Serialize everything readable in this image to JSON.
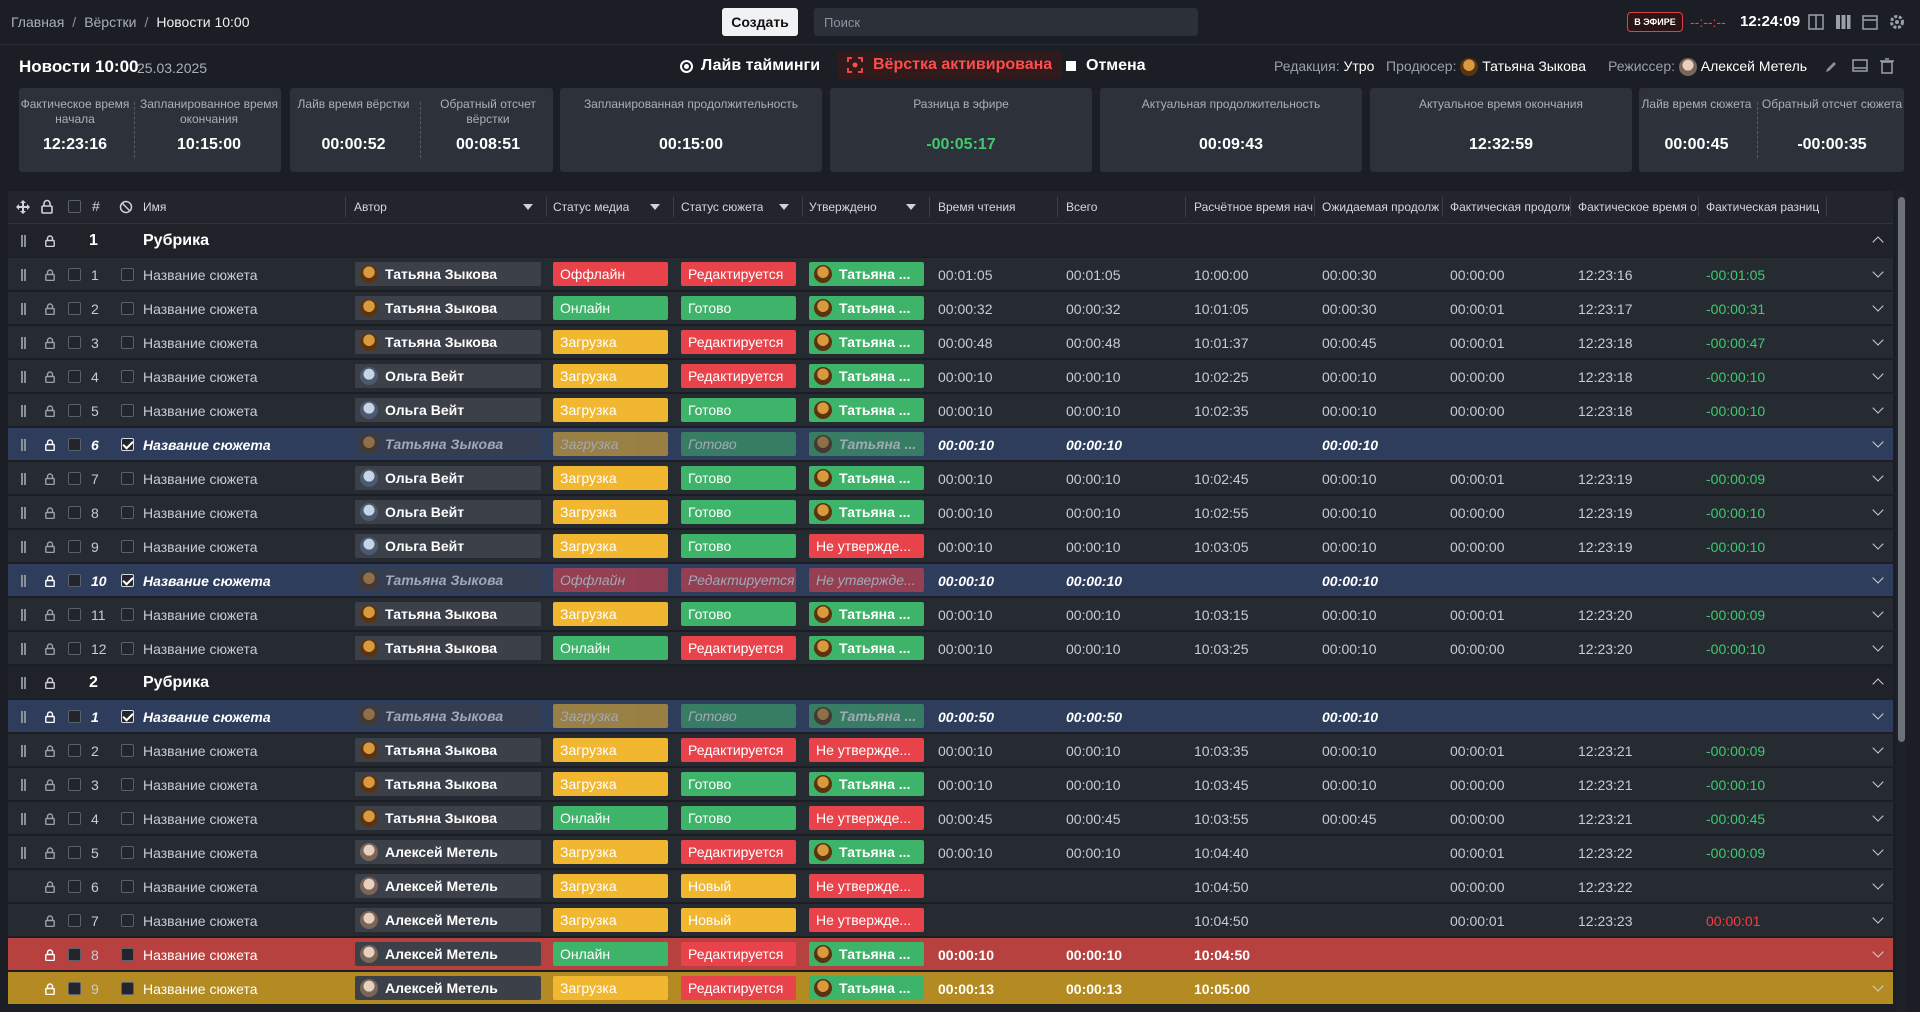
{
  "breadcrumb": [
    "Главная",
    "Вёрстки",
    "Новости 10:00"
  ],
  "toolbar": {
    "create_label": "Создать",
    "search_placeholder": "Поиск",
    "onair_label": "В ЭФИРЕ",
    "countdown": "--:--:--",
    "clock": "12:24:09"
  },
  "page": {
    "title": "Новости 10:00",
    "date": "25.03.2025",
    "live_timings": "Лайв тайминги",
    "activated": "Вёрстка активирована",
    "cancel": "Отмена",
    "edition_label": "Редакция:",
    "edition": "Утро",
    "producer_label": "Продюсер:",
    "producer": "Татьяна Зыкова",
    "director_label": "Режиссер:",
    "director": "Алексей Метель"
  },
  "panels": {
    "actual_start_label": "Фактическое время начала",
    "actual_start": "12:23:16",
    "planned_end_label": "Запланированное время окончания",
    "planned_end": "10:15:00",
    "live_layout_label": "Лайв время вёрстки",
    "live_layout": "00:00:52",
    "countdown_layout_label": "Обратный отсчет вёрстки",
    "countdown_layout": "00:08:51",
    "planned_duration_label": "Запланированная продолжительность",
    "planned_duration": "00:15:00",
    "air_diff_label": "Разница в эфире",
    "air_diff": "-00:05:17",
    "actual_duration_label": "Актуальная продолжительность",
    "actual_duration": "00:09:43",
    "actual_end_label": "Актуальное время окончания",
    "actual_end": "12:32:59",
    "live_story_label": "Лайв время сюжета",
    "live_story": "00:00:45",
    "countdown_story_label": "Обратный отсчет сюжета",
    "countdown_story": "-00:00:35"
  },
  "columns": {
    "name": "Имя",
    "author": "Автор",
    "media": "Статус медиа",
    "story": "Статус сюжета",
    "approved": "Утверждено",
    "read": "Время чтения",
    "total": "Всего",
    "calc": "Расчётное время нач",
    "expected": "Ожидаемая продолж",
    "actual_dur": "Фактическая продолж",
    "actual_time": "Фактическое время о",
    "actual_diff": "Фактическая разниц"
  },
  "groups": [
    {
      "num": "1",
      "title": "Рубрика",
      "rows": [
        {
          "n": "1",
          "name": "Название сюжета",
          "author": "Татьяна Зыкова",
          "av": "t",
          "media": "Оффлайн",
          "story": "Редактируется",
          "appr": "Татьяна ...",
          "read": "00:01:05",
          "total": "00:01:05",
          "calc": "10:00:00",
          "exp": "00:00:30",
          "adur": "00:00:00",
          "atime": "12:23:16",
          "diff": "-00:01:05"
        },
        {
          "n": "2",
          "name": "Название сюжета",
          "author": "Татьяна Зыкова",
          "av": "t",
          "media": "Онлайн",
          "story": "Готово",
          "appr": "Татьяна ...",
          "read": "00:00:32",
          "total": "00:00:32",
          "calc": "10:01:05",
          "exp": "00:00:30",
          "adur": "00:00:01",
          "atime": "12:23:17",
          "diff": "-00:00:31"
        },
        {
          "n": "3",
          "name": "Название сюжета",
          "author": "Татьяна Зыкова",
          "av": "t",
          "media": "Загрузка",
          "story": "Редактируется",
          "appr": "Татьяна ...",
          "read": "00:00:48",
          "total": "00:00:48",
          "calc": "10:01:37",
          "exp": "00:00:45",
          "adur": "00:00:01",
          "atime": "12:23:18",
          "diff": "-00:00:47"
        },
        {
          "n": "4",
          "name": "Название сюжета",
          "author": "Ольга Вейт",
          "av": "o",
          "media": "Загрузка",
          "story": "Редактируется",
          "appr": "Татьяна ...",
          "read": "00:00:10",
          "total": "00:00:10",
          "calc": "10:02:25",
          "exp": "00:00:10",
          "adur": "00:00:00",
          "atime": "12:23:18",
          "diff": "-00:00:10"
        },
        {
          "n": "5",
          "name": "Название сюжета",
          "author": "Ольга Вейт",
          "av": "o",
          "media": "Загрузка",
          "story": "Готово",
          "appr": "Татьяна ...",
          "read": "00:00:10",
          "total": "00:00:10",
          "calc": "10:02:35",
          "exp": "00:00:10",
          "adur": "00:00:00",
          "atime": "12:23:18",
          "diff": "-00:00:10"
        },
        {
          "n": "6",
          "name": "Название сюжета",
          "author": "Татьяна Зыкова",
          "av": "t",
          "media": "Загрузка",
          "story": "Готово",
          "appr": "Татьяна ...",
          "read": "00:00:10",
          "total": "00:00:10",
          "calc": "",
          "exp": "00:00:10",
          "adur": "",
          "atime": "",
          "diff": "",
          "state": "sel"
        },
        {
          "n": "7",
          "name": "Название сюжета",
          "author": "Ольга Вейт",
          "av": "o",
          "media": "Загрузка",
          "story": "Готово",
          "appr": "Татьяна ...",
          "read": "00:00:10",
          "total": "00:00:10",
          "calc": "10:02:45",
          "exp": "00:00:10",
          "adur": "00:00:01",
          "atime": "12:23:19",
          "diff": "-00:00:09"
        },
        {
          "n": "8",
          "name": "Название сюжета",
          "author": "Ольга Вейт",
          "av": "o",
          "media": "Загрузка",
          "story": "Готово",
          "appr": "Татьяна ...",
          "read": "00:00:10",
          "total": "00:00:10",
          "calc": "10:02:55",
          "exp": "00:00:10",
          "adur": "00:00:00",
          "atime": "12:23:19",
          "diff": "-00:00:10"
        },
        {
          "n": "9",
          "name": "Название сюжета",
          "author": "Ольга Вейт",
          "av": "o",
          "media": "Загрузка",
          "story": "Готово",
          "appr": "Не утвержде...",
          "read": "00:00:10",
          "total": "00:00:10",
          "calc": "10:03:05",
          "exp": "00:00:10",
          "adur": "00:00:00",
          "atime": "12:23:19",
          "diff": "-00:00:10"
        },
        {
          "n": "10",
          "name": "Название сюжета",
          "author": "Татьяна Зыкова",
          "av": "t",
          "media": "Оффлайн",
          "story": "Редактируется",
          "appr": "Не утвержде...",
          "read": "00:00:10",
          "total": "00:00:10",
          "calc": "",
          "exp": "00:00:10",
          "adur": "",
          "atime": "",
          "diff": "",
          "state": "sel"
        },
        {
          "n": "11",
          "name": "Название сюжета",
          "author": "Татьяна Зыкова",
          "av": "t",
          "media": "Загрузка",
          "story": "Готово",
          "appr": "Татьяна ...",
          "read": "00:00:10",
          "total": "00:00:10",
          "calc": "10:03:15",
          "exp": "00:00:10",
          "adur": "00:00:01",
          "atime": "12:23:20",
          "diff": "-00:00:09"
        },
        {
          "n": "12",
          "name": "Название сюжета",
          "author": "Татьяна Зыкова",
          "av": "t",
          "media": "Онлайн",
          "story": "Редактируется",
          "appr": "Татьяна ...",
          "read": "00:00:10",
          "total": "00:00:10",
          "calc": "10:03:25",
          "exp": "00:00:10",
          "adur": "00:00:00",
          "atime": "12:23:20",
          "diff": "-00:00:10"
        }
      ]
    },
    {
      "num": "2",
      "title": "Рубрика",
      "rows": [
        {
          "n": "1",
          "name": "Название сюжета",
          "author": "Татьяна Зыкова",
          "av": "t",
          "media": "Загрузка",
          "story": "Готово",
          "appr": "Татьяна ...",
          "read": "00:00:50",
          "total": "00:00:50",
          "calc": "",
          "exp": "00:00:10",
          "adur": "",
          "atime": "",
          "diff": "",
          "state": "sel"
        },
        {
          "n": "2",
          "name": "Название сюжета",
          "author": "Татьяна Зыкова",
          "av": "t",
          "media": "Загрузка",
          "story": "Редактируется",
          "appr": "Не утвержде...",
          "read": "00:00:10",
          "total": "00:00:10",
          "calc": "10:03:35",
          "exp": "00:00:10",
          "adur": "00:00:01",
          "atime": "12:23:21",
          "diff": "-00:00:09"
        },
        {
          "n": "3",
          "name": "Название сюжета",
          "author": "Татьяна Зыкова",
          "av": "t",
          "media": "Загрузка",
          "story": "Готово",
          "appr": "Татьяна ...",
          "read": "00:00:10",
          "total": "00:00:10",
          "calc": "10:03:45",
          "exp": "00:00:10",
          "adur": "00:00:00",
          "atime": "12:23:21",
          "diff": "-00:00:10"
        },
        {
          "n": "4",
          "name": "Название сюжета",
          "author": "Татьяна Зыкова",
          "av": "t",
          "media": "Онлайн",
          "story": "Готово",
          "appr": "Не утвержде...",
          "read": "00:00:45",
          "total": "00:00:45",
          "calc": "10:03:55",
          "exp": "00:00:45",
          "adur": "00:00:00",
          "atime": "12:23:21",
          "diff": "-00:00:45"
        },
        {
          "n": "5",
          "name": "Название сюжета",
          "author": "Алексей Метель",
          "av": "a",
          "media": "Загрузка",
          "story": "Редактируется",
          "appr": "Татьяна ...",
          "read": "00:00:10",
          "total": "00:00:10",
          "calc": "10:04:40",
          "exp": "",
          "adur": "00:00:01",
          "atime": "12:23:22",
          "diff": "-00:00:09"
        },
        {
          "n": "6",
          "name": "Название сюжета",
          "author": "Алексей Метель",
          "av": "a",
          "media": "Загрузка",
          "story": "Новый",
          "appr": "Не утвержде...",
          "read": "",
          "total": "",
          "calc": "10:04:50",
          "exp": "",
          "adur": "00:00:00",
          "atime": "12:23:22",
          "diff": "",
          "nodrag": true
        },
        {
          "n": "7",
          "name": "Название сюжета",
          "author": "Алексей Метель",
          "av": "a",
          "media": "Загрузка",
          "story": "Новый",
          "appr": "Не утвержде...",
          "read": "",
          "total": "",
          "calc": "10:04:50",
          "exp": "",
          "adur": "00:00:01",
          "atime": "12:23:23",
          "diff": "00:00:01",
          "diffred": true,
          "nodrag": true
        },
        {
          "n": "8",
          "name": "Название сюжета",
          "author": "Алексей Метель",
          "av": "a",
          "media": "Онлайн",
          "story": "Редактируется",
          "appr": "Татьяна ...",
          "read": "00:00:10",
          "total": "00:00:10",
          "calc": "10:04:50",
          "exp": "",
          "adur": "",
          "atime": "",
          "diff": "",
          "state": "red",
          "nodrag": true
        },
        {
          "n": "9",
          "name": "Название сюжета",
          "author": "Алексей Метель",
          "av": "a",
          "media": "Загрузка",
          "story": "Редактируется",
          "appr": "Татьяна ...",
          "read": "00:00:13",
          "total": "00:00:13",
          "calc": "10:05:00",
          "exp": "",
          "adur": "",
          "atime": "",
          "diff": "",
          "state": "yel",
          "nodrag": true
        }
      ]
    }
  ],
  "colors": {
    "offline": "#e8424a",
    "online": "#3eb36a",
    "loading": "#f2b731",
    "editing": "#e8424a",
    "ready": "#3eb36a",
    "new": "#f2b731",
    "approved": "#3eb36a",
    "not_approved": "#e8424a",
    "diff_green": "#41c96f",
    "diff_red": "#ff3b3b"
  }
}
